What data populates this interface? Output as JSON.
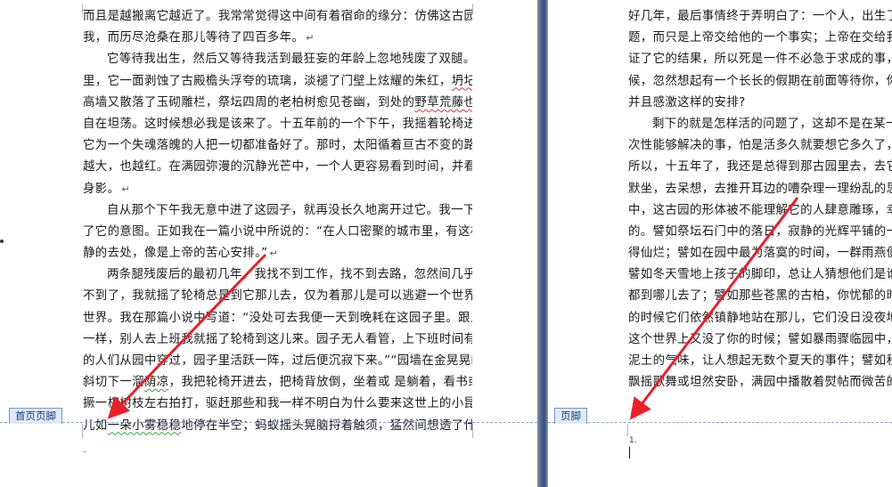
{
  "left_page": {
    "lines": [
      {
        "text": "而且是越搬离它越近了。我常常觉得这中间有着宿命的缘分：仿佛这古园就是为了等",
        "indent": false,
        "mark": ""
      },
      {
        "text": "我，而历尽沧桑在那儿等待了四百多年。",
        "indent": false,
        "mark": "↵"
      },
      {
        "text": "它等待我出生，然后又等待我活到最狂妄的年龄上忽地残废了双腿。四百多年",
        "indent": true,
        "mark": ""
      },
      {
        "text": "里，它一面剥蚀了古殿檐头浮夸的琉璃，淡褪了门壁上炫耀的朱红，坍圮了一段段",
        "indent": false,
        "mark": ""
      },
      {
        "text": "高墙又散落了玉砌雕栏，祭坛四周的老柏树愈见苍幽，到处的野草荒藤也都茂盛得",
        "indent": false,
        "mark": ""
      },
      {
        "text": "自在坦荡。这时候想必我是该来了。十五年前的一个下午，我摇着轮椅进入园中，",
        "indent": false,
        "mark": ""
      },
      {
        "text": "它为一个失魂落魄的人把一切都准备好了。那时，太阳循着亘古不变的路途正越来",
        "indent": false,
        "mark": ""
      },
      {
        "text": "越大，也越红。在满园弥漫的沉静光芒中，一个人更容易看到时间，并看见自己的",
        "indent": false,
        "mark": ""
      },
      {
        "text": "身影。",
        "indent": false,
        "mark": "↵"
      },
      {
        "text": "自从那个下午我无意中进了这园子，就再没长久地离开过它。我一下子就理解",
        "indent": true,
        "mark": ""
      },
      {
        "text": "了它的意图。正如我在一篇小说中所说的：“在人口密聚的城市里，有这样一个宁",
        "indent": false,
        "mark": ""
      },
      {
        "text": "静的去处，像是上帝的苦心安排。”",
        "indent": false,
        "mark": "↵"
      },
      {
        "text": "两条腿残废后的最初几年，我找不到工作，找不到去路，忽然间几乎什么都找",
        "indent": true,
        "mark": ""
      },
      {
        "text": "不到了，我就摇了轮椅总是到它那儿去，仅为着那儿是可以逃避一个世界的另一个",
        "indent": false,
        "mark": ""
      },
      {
        "text": "世界。我在那篇小说中写道：“没处可去我便一天到晚耗在这园子里。跟上班下班",
        "indent": false,
        "mark": ""
      },
      {
        "text": "一样，别人去上班我就摇了轮椅到这儿来。园子无人看管，上下班时间有些抄近路",
        "indent": false,
        "mark": ""
      },
      {
        "text": "的人们从园中穿过，园子里活跃一阵，过后便沉寂下来。”“园墙在金晃晃的空气中",
        "indent": false,
        "mark": ""
      },
      {
        "text": "斜切下一溜荫凉，我把轮椅开进去，把椅背放倒，坐着或 是躺着，看书或者想事，",
        "indent": false,
        "mark": ""
      },
      {
        "text": "撅一杈树枝左右拍打，驱赶那些和我一样不明白为什么要来这世上的小昆虫。”“蜂",
        "indent": false,
        "mark": ""
      },
      {
        "text": "儿如一朵小雾稳稳地停在半空；蚂蚁摇头晃脑捋着触须，猛然间想透了什么，转身",
        "indent": false,
        "mark": ""
      }
    ],
    "footer_tag": "首页页脚"
  },
  "right_page": {
    "lines": [
      {
        "text": "好几年，最后事情终于弄明白了：一个人，出生了，这",
        "indent": false
      },
      {
        "text": "题，而只是上帝交给他的一个事实；上帝在交给我们这",
        "indent": false
      },
      {
        "text": "证了它的结果，所以死是一件不必急于求成的事，死是",
        "indent": false
      },
      {
        "text": "候，忽然想起有一个长长的假期在前面等待你，你会不",
        "indent": false
      },
      {
        "text": "并且感激这样的安排?",
        "indent": false
      },
      {
        "text": "剩下的就是怎样活的问题了，这却不是在某一个瞬间",
        "indent": true
      },
      {
        "text": "次性能够解决的事，怕是活多久就要想它多久了，就像",
        "indent": false
      },
      {
        "text": "所以，十五年了，我还是总得到那古园里去，去它的老",
        "indent": false
      },
      {
        "text": "默坐，去呆想，去推开耳边的嘈杂理一理纷乱的思绪，",
        "indent": false
      },
      {
        "text": "中，这古园的形体被不能理解它的人肆意雕琢，幸好有",
        "indent": false
      },
      {
        "text": "的。譬如祭坛石门中的落日，寂静的光辉平铺的一刻，",
        "indent": false
      },
      {
        "text": "得仙烂；譬如在园中最为落寞的时间，一群雨燕便出来",
        "indent": false
      },
      {
        "text": "譬如冬天雪地上孩子的脚印，总让人猜想他们是谁，曾",
        "indent": false
      },
      {
        "text": "都到哪儿去了；譬如那些苍黑的古柏，你忧郁的时候它",
        "indent": false
      },
      {
        "text": "的时候它们依然镇静地站在那儿，它们没日没夜地站在",
        "indent": false
      },
      {
        "text": "这个世界上又没了你的时候；譬如暴雨骤临园中，激起",
        "indent": false
      },
      {
        "text": "泥土的气味，让人想起无数个夏天的事件；譬如秋风忽",
        "indent": false
      },
      {
        "text": "飘摇歌舞或坦然安卧，满园中播散着熨帖而微苦的味",
        "indent": false
      }
    ],
    "footer_tag": "页脚",
    "footer_number": "1."
  }
}
